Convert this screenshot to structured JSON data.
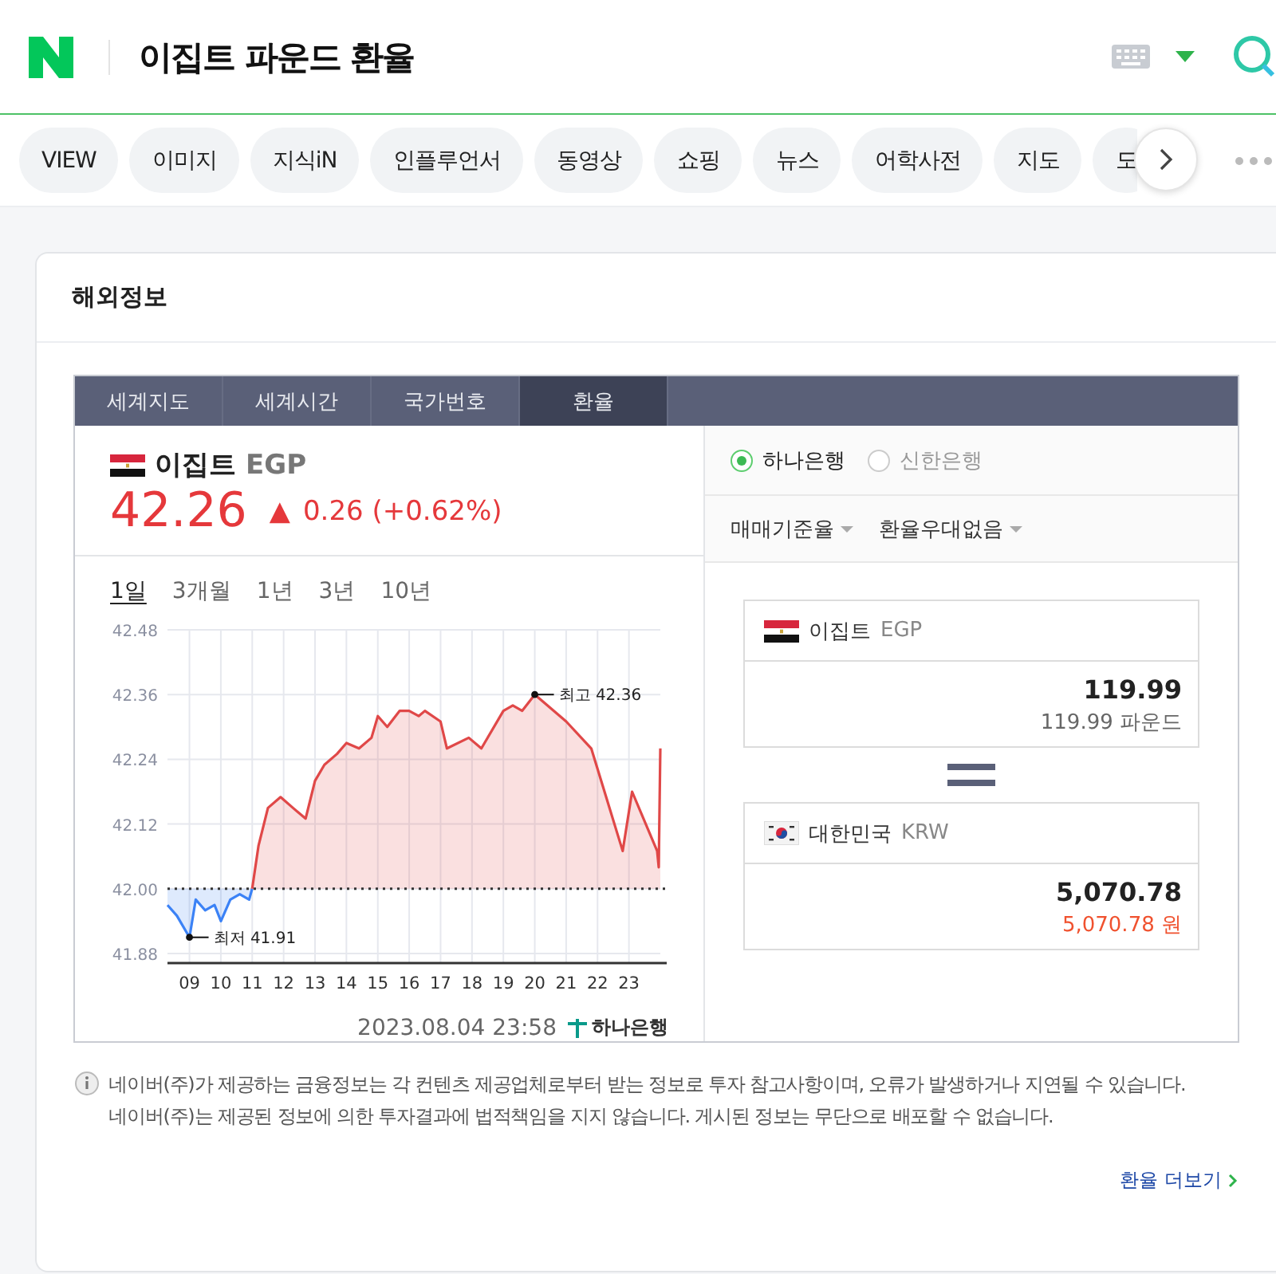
{
  "header": {
    "query": "이집트 파운드 환율"
  },
  "tabs": [
    {
      "label": "VIEW",
      "selected": false
    },
    {
      "label": "이미지",
      "selected": false
    },
    {
      "label": "지식iN",
      "selected": false
    },
    {
      "label": "인플루언서",
      "selected": false
    },
    {
      "label": "동영상",
      "selected": false
    },
    {
      "label": "쇼핑",
      "selected": false
    },
    {
      "label": "뉴스",
      "selected": false
    },
    {
      "label": "어학사전",
      "selected": false
    },
    {
      "label": "지도",
      "selected": false
    },
    {
      "label": "도",
      "selected": false
    }
  ],
  "card": {
    "title": "해외정보",
    "widget_tabs": [
      {
        "label": "세계지도",
        "selected": false
      },
      {
        "label": "세계시간",
        "selected": false
      },
      {
        "label": "국가번호",
        "selected": false
      },
      {
        "label": "환율",
        "selected": true
      }
    ],
    "currency": {
      "country": "이집트",
      "code": "EGP",
      "price": "42.26",
      "arrow": "▲",
      "change": "0.26 (+0.62%)"
    },
    "periods": [
      {
        "label": "1일",
        "selected": true
      },
      {
        "label": "3개월",
        "selected": false
      },
      {
        "label": "1년",
        "selected": false
      },
      {
        "label": "3년",
        "selected": false
      },
      {
        "label": "10년",
        "selected": false
      }
    ],
    "chart_data": {
      "type": "line",
      "x": [
        8.3,
        8.6,
        9.0,
        9.2,
        9.5,
        9.8,
        10.0,
        10.3,
        10.6,
        10.9,
        11.0,
        11.2,
        11.5,
        11.9,
        12.3,
        12.7,
        13.0,
        13.3,
        13.7,
        14.0,
        14.4,
        14.8,
        15.0,
        15.3,
        15.7,
        16.0,
        16.3,
        16.5,
        17.0,
        17.2,
        17.9,
        18.3,
        19.0,
        19.3,
        19.6,
        20.0,
        21.0,
        21.8,
        22.8,
        23.1,
        23.9,
        23.95,
        24.0
      ],
      "series": [
        {
          "color": "#3b82f6",
          "values": [
            41.97,
            41.95,
            41.91,
            41.98,
            41.96,
            41.97,
            41.94,
            41.98,
            41.99,
            41.98,
            42.0,
            null,
            null,
            null,
            null,
            null,
            null,
            null,
            null,
            null,
            null,
            null,
            null,
            null,
            null,
            null,
            null,
            null,
            null,
            null,
            null,
            null,
            null,
            null,
            null,
            null,
            null,
            null,
            null,
            null,
            null,
            null,
            null
          ]
        },
        {
          "color": "#e04848",
          "values": [
            null,
            null,
            null,
            null,
            null,
            null,
            null,
            null,
            null,
            null,
            42.0,
            42.08,
            42.15,
            42.17,
            42.15,
            42.13,
            42.2,
            42.23,
            42.25,
            42.27,
            42.26,
            42.28,
            42.32,
            42.3,
            42.33,
            42.33,
            42.32,
            42.33,
            42.31,
            42.26,
            42.28,
            42.26,
            42.33,
            42.34,
            42.33,
            42.36,
            42.31,
            42.26,
            42.07,
            42.18,
            42.07,
            42.04,
            42.26
          ]
        }
      ],
      "xlim": [
        8.3,
        24.0
      ],
      "ylim": [
        41.88,
        42.48
      ],
      "xticks": [
        {
          "value": 9,
          "label": "09"
        },
        {
          "value": 10,
          "label": "10"
        },
        {
          "value": 11,
          "label": "11"
        },
        {
          "value": 12,
          "label": "12"
        },
        {
          "value": 13,
          "label": "13"
        },
        {
          "value": 14,
          "label": "14"
        },
        {
          "value": 15,
          "label": "15"
        },
        {
          "value": 16,
          "label": "16"
        },
        {
          "value": 17,
          "label": "17"
        },
        {
          "value": 18,
          "label": "18"
        },
        {
          "value": 19,
          "label": "19"
        },
        {
          "value": 20,
          "label": "20"
        },
        {
          "value": 21,
          "label": "21"
        },
        {
          "value": 22,
          "label": "22"
        },
        {
          "value": 23,
          "label": "23"
        }
      ],
      "yticks": [
        {
          "value": 41.88,
          "label": "41.88"
        },
        {
          "value": 42.0,
          "label": "42.00"
        },
        {
          "value": 42.12,
          "label": "42.12"
        },
        {
          "value": 42.24,
          "label": "42.24"
        },
        {
          "value": 42.36,
          "label": "42.36"
        },
        {
          "value": 42.48,
          "label": "42.48"
        }
      ],
      "grid": true,
      "ref_lines": [
        {
          "axis": "y",
          "value": 42.0
        }
      ],
      "annotations": [
        {
          "x": 9.0,
          "y": 41.91,
          "text": "최저 41.91"
        },
        {
          "x": 20.0,
          "y": 42.36,
          "text": "최고 42.36"
        }
      ]
    },
    "timestamp": "2023.08.04 23:58",
    "source": "하나은행",
    "banks": [
      {
        "label": "하나은행",
        "selected": true
      },
      {
        "label": "신한은행",
        "selected": false
      }
    ],
    "dropdowns": [
      "매매기준율",
      "환율우대없음"
    ],
    "from": {
      "country": "이집트",
      "code": "EGP",
      "amount": "119.99",
      "reading": "119.99 파운드"
    },
    "to": {
      "country": "대한민국",
      "code": "KRW",
      "amount": "5,070.78",
      "reading": "5,070.78 원"
    },
    "notice": [
      "네이버(주)가 제공하는 금융정보는 각 컨텐츠 제공업체로부터 받는 정보로 투자 참고사항이며, 오류가 발생하거나 지연될 수 있습니다.",
      "네이버(주)는 제공된 정보에 의한 투자결과에 법적책임을 지지 않습니다. 게시된 정보는 무단으로 배포할 수 없습니다."
    ],
    "more_link": "환율 더보기"
  }
}
